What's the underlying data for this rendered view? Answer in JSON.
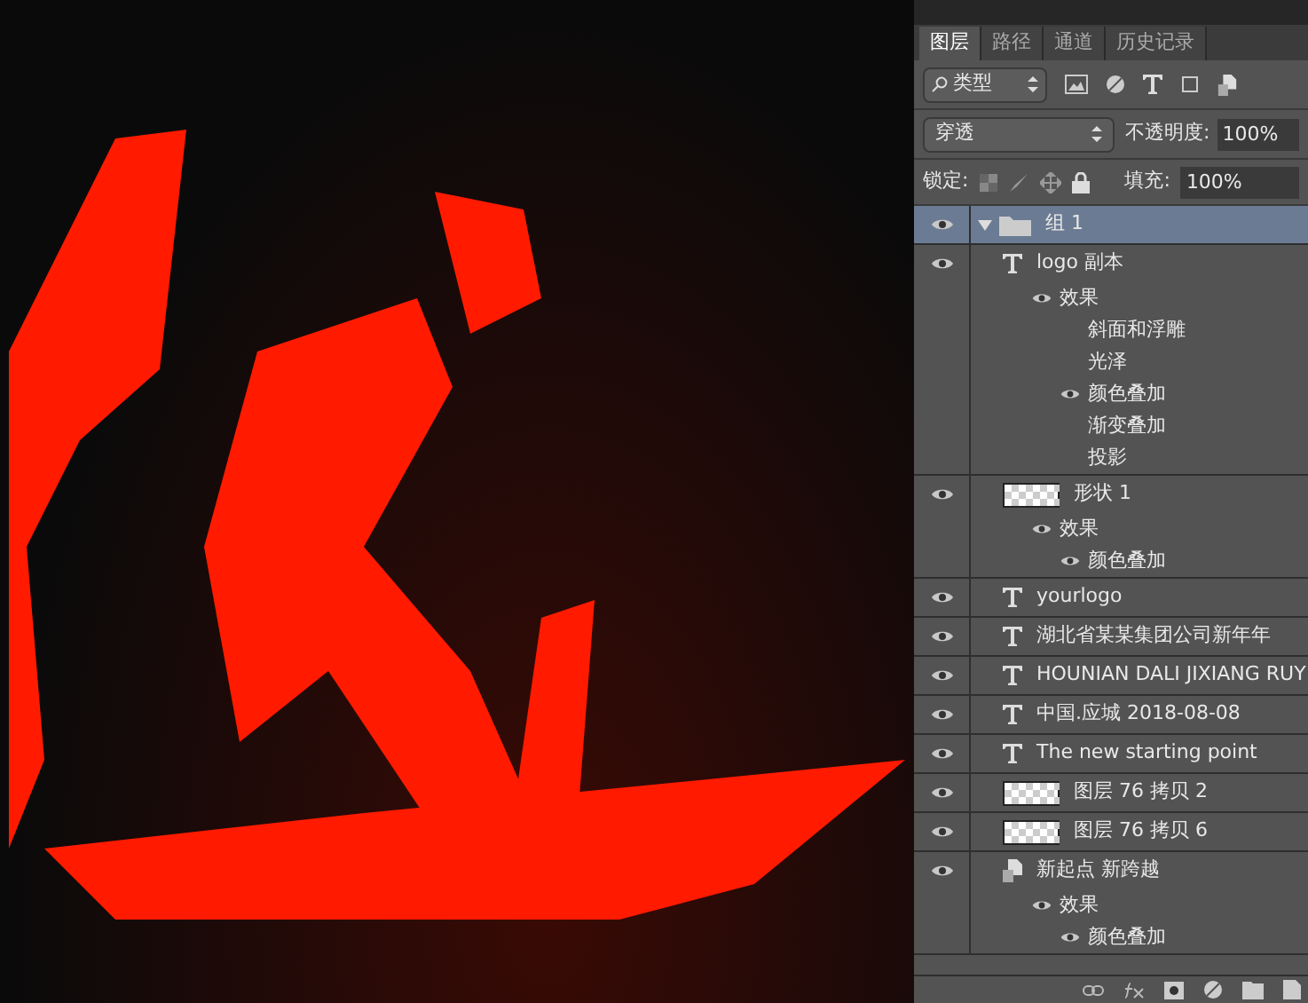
{
  "tabs": [
    {
      "label": "图层",
      "selected": true
    },
    {
      "label": "路径",
      "selected": false
    },
    {
      "label": "通道",
      "selected": false
    },
    {
      "label": "历史记录",
      "selected": false
    }
  ],
  "filter": {
    "value": "类型"
  },
  "blend": {
    "value": "穿透",
    "opacity_label": "不透明度:",
    "opacity": "100%"
  },
  "lock": {
    "label": "锁定:",
    "fill_label": "填充:",
    "fill": "100%"
  },
  "layers": [
    {
      "kind": "group",
      "name": "组 1",
      "visible": true,
      "selected": true,
      "expanded": true
    },
    {
      "kind": "text",
      "name": "logo 副本",
      "visible": true,
      "selected": false,
      "effects": {
        "label": "效果",
        "visible": true,
        "items": [
          {
            "name": "斜面和浮雕",
            "visible": false
          },
          {
            "name": "光泽",
            "visible": false
          },
          {
            "name": "颜色叠加",
            "visible": true
          },
          {
            "name": "渐变叠加",
            "visible": false
          },
          {
            "name": "投影",
            "visible": false
          }
        ]
      }
    },
    {
      "kind": "shape",
      "name": "形状 1",
      "visible": true,
      "selected": false,
      "effects": {
        "label": "效果",
        "visible": true,
        "items": [
          {
            "name": "颜色叠加",
            "visible": true
          }
        ]
      }
    },
    {
      "kind": "text",
      "name": "yourlogo",
      "visible": true,
      "selected": false
    },
    {
      "kind": "text",
      "name": "湖北省某某集团公司新年年",
      "visible": true,
      "selected": false
    },
    {
      "kind": "text",
      "name": "HOUNIAN DALI JIXIANG RUY",
      "visible": true,
      "selected": false
    },
    {
      "kind": "text",
      "name": "中国.应城 2018-08-08",
      "visible": true,
      "selected": false
    },
    {
      "kind": "text",
      "name": "The new   starting point",
      "visible": true,
      "selected": false
    },
    {
      "kind": "pixel",
      "name": "图层 76 拷贝 2",
      "visible": true,
      "selected": false
    },
    {
      "kind": "pixel",
      "name": "图层 76 拷贝 6",
      "visible": true,
      "selected": false
    },
    {
      "kind": "smart",
      "name": "新起点 新跨越",
      "visible": true,
      "selected": false,
      "effects": {
        "label": "效果",
        "visible": true,
        "items": [
          {
            "name": "颜色叠加",
            "visible": true
          }
        ]
      }
    }
  ]
}
